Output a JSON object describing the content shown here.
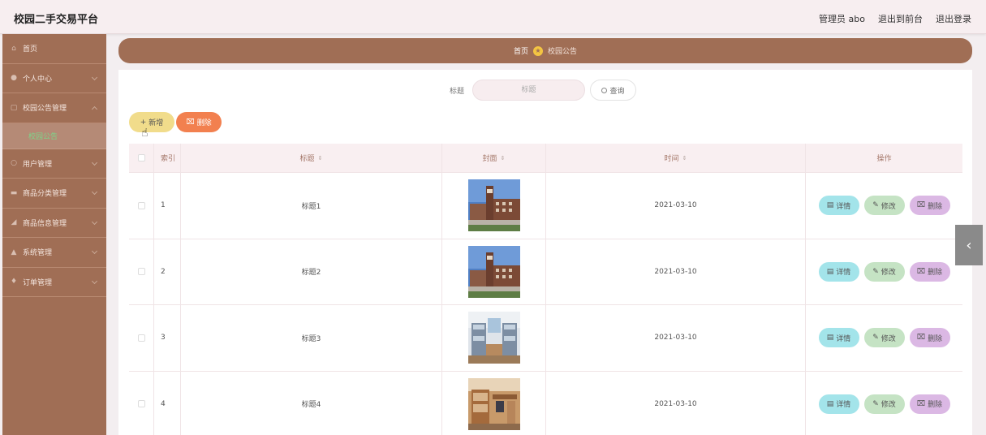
{
  "header": {
    "title": "校园二手交易平台",
    "admin": "管理员 abo",
    "to_front": "退出到前台",
    "logout": "退出登录"
  },
  "sidebar": {
    "items": [
      {
        "label": "首页",
        "icon": "home-icon"
      },
      {
        "label": "个人中心",
        "icon": "user-icon"
      },
      {
        "label": "校园公告管理",
        "icon": "notice-icon"
      },
      {
        "label": "用户管理",
        "icon": "users-icon"
      },
      {
        "label": "商品分类管理",
        "icon": "category-icon"
      },
      {
        "label": "商品信息管理",
        "icon": "goods-icon"
      },
      {
        "label": "系统管理",
        "icon": "system-icon"
      },
      {
        "label": "订单管理",
        "icon": "order-icon"
      }
    ],
    "active_sub": "校园公告"
  },
  "breadcrumb": {
    "home": "首页",
    "current": "校园公告"
  },
  "search": {
    "label": "标题",
    "placeholder": "标题",
    "button": "查询"
  },
  "actions": {
    "add": "新增",
    "delete": "删除"
  },
  "table": {
    "headers": {
      "index": "索引",
      "title": "标题",
      "cover": "封面",
      "time": "时间",
      "ops": "操作"
    },
    "rows": [
      {
        "index": "1",
        "title": "标题1",
        "time": "2021-03-10",
        "cover": "building"
      },
      {
        "index": "2",
        "title": "标题2",
        "time": "2021-03-10",
        "cover": "building"
      },
      {
        "index": "3",
        "title": "标题3",
        "time": "2021-03-10",
        "cover": "dorm-bunk"
      },
      {
        "index": "4",
        "title": "标题4",
        "time": "2021-03-10",
        "cover": "dorm-desk"
      }
    ],
    "ops": {
      "detail": "详情",
      "edit": "修改",
      "delete": "删除"
    }
  }
}
